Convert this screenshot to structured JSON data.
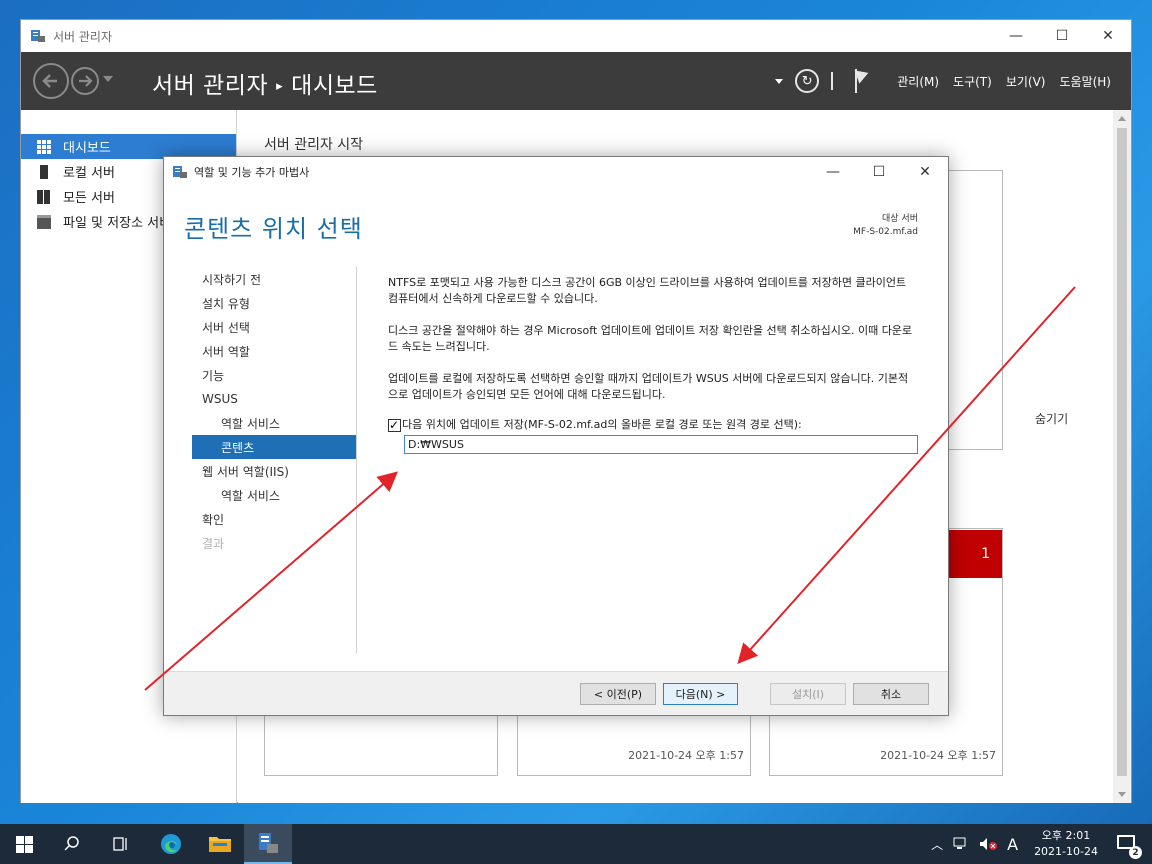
{
  "server_manager": {
    "window_title": "서버 관리자",
    "breadcrumb": {
      "root": "서버 관리자",
      "separator": "▸",
      "current": "대시보드"
    },
    "menu": [
      "관리(M)",
      "도구(T)",
      "보기(V)",
      "도움말(H)"
    ],
    "sidebar": [
      {
        "label": "대시보드",
        "icon": "dashboard-icon",
        "active": true
      },
      {
        "label": "로컬 서버",
        "icon": "local-server-icon"
      },
      {
        "label": "모든 서버",
        "icon": "all-servers-icon"
      },
      {
        "label": "파일 및 저장소 서비스",
        "icon": "file-storage-icon"
      }
    ],
    "main": {
      "section_title": "서버 관리자 시작",
      "hide_link": "숨기기",
      "badge_count": "1",
      "tile_timestamps": [
        "2021-10-24 오후 1:57",
        "2021-10-24 오후 1:57"
      ]
    }
  },
  "wizard": {
    "window_title": "역할 및 기능 추가 마법사",
    "heading": "콘텐츠 위치 선택",
    "destination": {
      "label": "대상 서버",
      "server": "MF-S-02.mf.ad"
    },
    "nav": [
      {
        "label": "시작하기 전",
        "level": 0
      },
      {
        "label": "설치 유형",
        "level": 0
      },
      {
        "label": "서버 선택",
        "level": 0
      },
      {
        "label": "서버 역할",
        "level": 0
      },
      {
        "label": "기능",
        "level": 0
      },
      {
        "label": "WSUS",
        "level": 0
      },
      {
        "label": "역할 서비스",
        "level": 1
      },
      {
        "label": "콘텐츠",
        "level": 1,
        "active": true
      },
      {
        "label": "웹 서버 역할(IIS)",
        "level": 0
      },
      {
        "label": "역할 서비스",
        "level": 1
      },
      {
        "label": "확인",
        "level": 0
      },
      {
        "label": "결과",
        "level": 0,
        "disabled": true
      }
    ],
    "paragraphs": [
      "NTFS로 포맷되고 사용 가능한 디스크 공간이 6GB 이상인 드라이브를 사용하여 업데이트를 저장하면 클라이언트 컴퓨터에서 신속하게 다운로드할 수 있습니다.",
      "디스크 공간을 절약해야 하는 경우 Microsoft 업데이트에 업데이트 저장 확인란을 선택 취소하십시오. 이때 다운로드 속도는 느려집니다.",
      "업데이트를 로컬에 저장하도록 선택하면 승인할 때까지 업데이트가 WSUS 서버에 다운로드되지 않습니다. 기본적으로 업데이트가 승인되면 모든 언어에 대해 다운로드됩니다."
    ],
    "store_checkbox": {
      "checked": true,
      "label": "다음 위치에 업데이트 저장(MF-S-02.mf.ad의 올바른 로컬 경로 또는 원격 경로 선택):"
    },
    "path_value": "D:₩WSUS",
    "buttons": {
      "prev": "< 이전(P)",
      "next": "다음(N) >",
      "install": "설치(I)",
      "cancel": "취소"
    }
  },
  "taskbar": {
    "ime": "A",
    "clock_time": "오후 2:01",
    "clock_date": "2021-10-24",
    "notification_count": "2"
  },
  "colors": {
    "accent": "#2d7dd2",
    "heading": "#1a6ea8",
    "header_bar": "#3c3c3c",
    "alert": "#c00000",
    "annotation": "#e0242a"
  }
}
